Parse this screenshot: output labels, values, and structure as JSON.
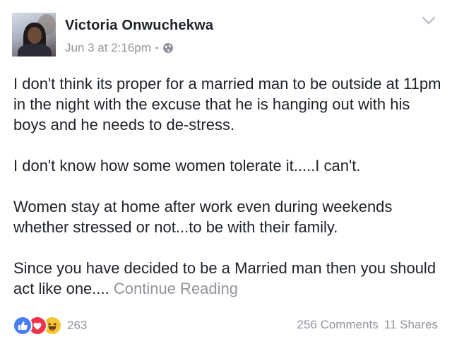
{
  "post": {
    "author": "Victoria Onwuchekwa",
    "timestamp": "Jun 3 at 2:16pm",
    "separator": "•",
    "privacy_icon": "globe-icon",
    "menu_icon": "chevron-down-icon",
    "paragraphs": [
      "I don't think its proper for a married man to be outside at 11pm in the night with the excuse that he is hanging out with his boys and he needs to de-stress.",
      "I don't know how some women tolerate it.....I can't.",
      "Women stay at home after work even during weekends whether stressed or not...to be with their family."
    ],
    "last_paragraph": "Since you have decided to be a Married man then you should act like one....",
    "continue_label": "Continue Reading"
  },
  "footer": {
    "reaction_icons": [
      "like-icon",
      "love-icon",
      "haha-icon"
    ],
    "reaction_count": "263",
    "comments": "256 Comments",
    "shares": "11 Shares"
  },
  "colors": {
    "text": "#1d2129",
    "meta": "#90949c",
    "like": "#4a7ef5",
    "love": "#f0334b",
    "haha": "#f7c632"
  }
}
